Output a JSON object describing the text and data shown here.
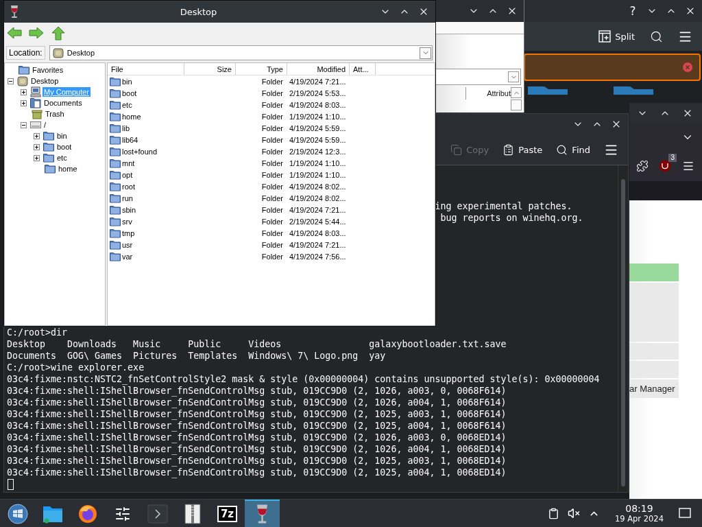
{
  "explorer": {
    "title": "Desktop",
    "location_label": "Location:",
    "location": "Desktop",
    "tree": [
      {
        "label": "Favorites",
        "kind": "favorites",
        "selected": false
      },
      {
        "label": "Desktop",
        "kind": "desktop",
        "expanded": true,
        "selected": false,
        "children": [
          {
            "label": "My Computer",
            "kind": "computer",
            "expanded": false,
            "selected": true
          },
          {
            "label": "Documents",
            "kind": "documents",
            "expanded": false,
            "selected": false
          },
          {
            "label": "Trash",
            "kind": "trash",
            "selected": false
          },
          {
            "label": "/",
            "kind": "drive",
            "expanded": true,
            "selected": false,
            "children": [
              {
                "label": "bin",
                "kind": "folder",
                "expanded": false,
                "selected": false
              },
              {
                "label": "boot",
                "kind": "folder",
                "expanded": false,
                "selected": false
              },
              {
                "label": "etc",
                "kind": "folder",
                "expanded": false,
                "selected": false
              },
              {
                "label": "home",
                "kind": "folder",
                "selected": false
              }
            ]
          }
        ]
      }
    ],
    "columns": [
      "File",
      "Size",
      "Type",
      "Modified",
      "Att..."
    ],
    "rows": [
      {
        "name": "bin",
        "type": "Folder",
        "modified": "4/19/2024 7:21..."
      },
      {
        "name": "boot",
        "type": "Folder",
        "modified": "2/19/2024 5:53..."
      },
      {
        "name": "etc",
        "type": "Folder",
        "modified": "4/19/2024 8:03..."
      },
      {
        "name": "home",
        "type": "Folder",
        "modified": "1/19/2024 1:10..."
      },
      {
        "name": "lib",
        "type": "Folder",
        "modified": "4/19/2024 5:59..."
      },
      {
        "name": "lib64",
        "type": "Folder",
        "modified": "4/19/2024 5:59..."
      },
      {
        "name": "lost+found",
        "type": "Folder",
        "modified": "2/19/2024 12:3..."
      },
      {
        "name": "mnt",
        "type": "Folder",
        "modified": "1/19/2024 1:10..."
      },
      {
        "name": "opt",
        "type": "Folder",
        "modified": "1/19/2024 1:10..."
      },
      {
        "name": "root",
        "type": "Folder",
        "modified": "4/19/2024 8:02..."
      },
      {
        "name": "run",
        "type": "Folder",
        "modified": "4/19/2024 8:02..."
      },
      {
        "name": "sbin",
        "type": "Folder",
        "modified": "4/19/2024 7:21..."
      },
      {
        "name": "srv",
        "type": "Folder",
        "modified": "2/19/2024 5:44..."
      },
      {
        "name": "tmp",
        "type": "Folder",
        "modified": "4/19/2024 8:03..."
      },
      {
        "name": "usr",
        "type": "Folder",
        "modified": "4/19/2024 7:21..."
      },
      {
        "name": "var",
        "type": "Folder",
        "modified": "4/19/2024 7:56..."
      }
    ]
  },
  "dolphin": {
    "help": "?",
    "split_label": "Split"
  },
  "wine_dialog": {
    "column_label": "Attribut"
  },
  "konsole": {
    "toolbar": [
      {
        "kind": "copy",
        "label": "Copy",
        "disabled": true
      },
      {
        "kind": "paste",
        "label": "Paste",
        "disabled": false
      },
      {
        "kind": "find",
        "label": "Find",
        "disabled": false
      }
    ],
    "partial_lines": [
      "ing experimental patches.",
      "bug reports on winehq.org."
    ],
    "lines": [
      "C:/root>dir",
      "Desktop    Downloads   Music     Public     Videos                galaxybootloader.txt.save",
      "Documents  GOG\\ Games  Pictures  Templates  Windows\\ 7\\ Logo.png  yay",
      "C:/root>wine explorer.exe",
      "03c4:fixme:nstc:NSTC2_fnSetControlStyle2 mask & style (0x00000004) contains unsupported style(s): 0x00000004",
      "03c4:fixme:shell:IShellBrowser_fnSendControlMsg stub, 019CC9D0 (2, 1026, a003, 0, 0068F614)",
      "03c4:fixme:shell:IShellBrowser_fnSendControlMsg stub, 019CC9D0 (2, 1026, a004, 1, 0068F614)",
      "03c4:fixme:shell:IShellBrowser_fnSendControlMsg stub, 019CC9D0 (2, 1025, a003, 1, 0068F614)",
      "03c4:fixme:shell:IShellBrowser_fnSendControlMsg stub, 019CC9D0 (2, 1025, a004, 1, 0068F614)",
      "03c4:fixme:shell:IShellBrowser_fnSendControlMsg stub, 019CC9D0 (2, 1026, a003, 0, 0068ED14)",
      "03c4:fixme:shell:IShellBrowser_fnSendControlMsg stub, 019CC9D0 (2, 1026, a004, 1, 0068ED14)",
      "03c4:fixme:shell:IShellBrowser_fnSendControlMsg stub, 019CC9D0 (2, 1025, a003, 1, 0068ED14)",
      "03c4:fixme:shell:IShellBrowser_fnSendControlMsg stub, 019CC9D0 (2, 1025, a004, 1, 0068ED14)"
    ]
  },
  "firefox": {
    "badge": "3",
    "table_label": "ar Manager"
  },
  "taskbar": {
    "apps": [
      {
        "kind": "start",
        "active": false
      },
      {
        "kind": "files",
        "active": false
      },
      {
        "kind": "firefox",
        "active": false
      },
      {
        "kind": "mixer",
        "active": false
      },
      {
        "kind": "terminal",
        "active": false
      },
      {
        "kind": "archive",
        "active": false
      },
      {
        "kind": "sevenzip",
        "label": "7z",
        "active": false
      },
      {
        "kind": "wine",
        "active": true
      }
    ],
    "time": "08:19",
    "date": "19 Apr 2024"
  }
}
